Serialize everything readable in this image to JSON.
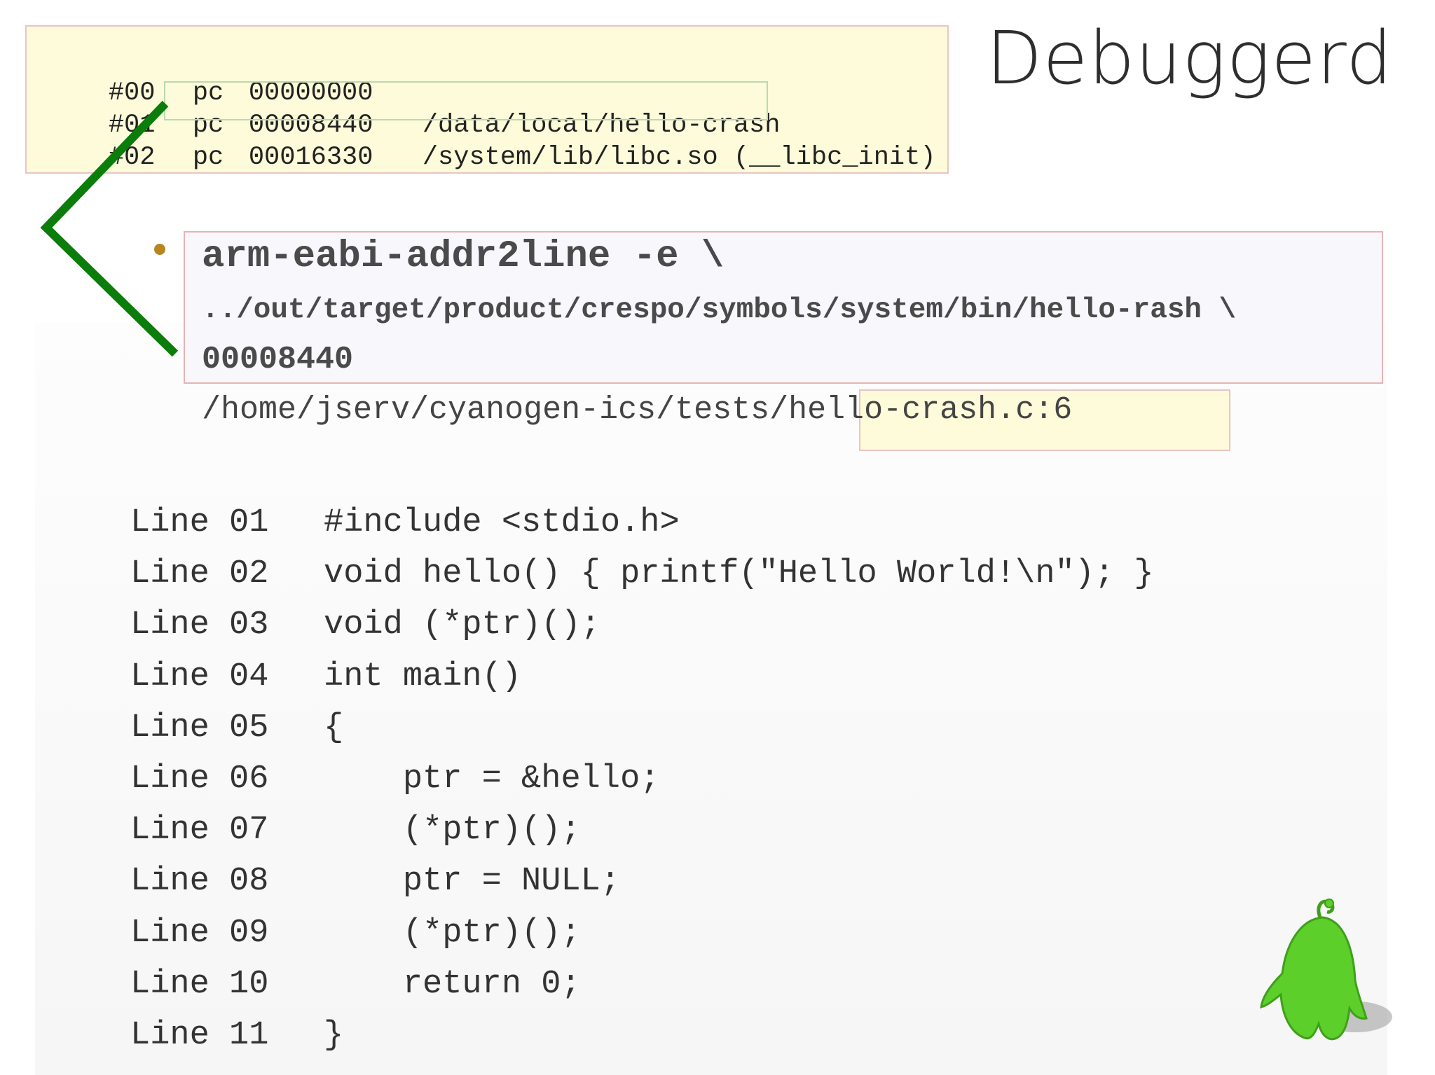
{
  "title": "Debuggerd",
  "backtrace": [
    {
      "frame": "#00",
      "pc": "pc",
      "addr": "00000000",
      "lib": ""
    },
    {
      "frame": "#01",
      "pc": "pc",
      "addr": "00008440",
      "lib": "/data/local/hello-crash"
    },
    {
      "frame": "#02",
      "pc": "pc",
      "addr": "00016330",
      "lib": "/system/lib/libc.so (__libc_init)"
    }
  ],
  "command": {
    "line1": "arm-eabi-addr2line -e \\",
    "line2": "../out/target/product/crespo/symbols/system/bin/hello-rash \\",
    "line3": "00008440"
  },
  "result": "/home/jserv/cyanogen-ics/tests/hello-crash.c:6",
  "source": [
    {
      "line": "Line 01",
      "code": "#include <stdio.h>"
    },
    {
      "line": "Line 02",
      "code": "void hello() { printf(\"Hello World!\\n\"); }"
    },
    {
      "line": "Line 03",
      "code": "void (*ptr)();"
    },
    {
      "line": "Line 04",
      "code": "int main()"
    },
    {
      "line": "Line 05",
      "code": "{"
    },
    {
      "line": "Line 06",
      "code": "    ptr = &hello;"
    },
    {
      "line": "Line 07",
      "code": "    (*ptr)();"
    },
    {
      "line": "Line 08",
      "code": "    ptr = NULL;"
    },
    {
      "line": "Line 09",
      "code": "    (*ptr)();"
    },
    {
      "line": "Line 10",
      "code": "    return 0;"
    },
    {
      "line": "Line 11",
      "code": "}"
    }
  ],
  "colors": {
    "arrow": "#0a7d0a",
    "highlight_fill": "#fdfbd9",
    "mascot": "#5ccf2a"
  },
  "icons": {
    "arrow": "green-chevron-arrow",
    "mascot": "android-mascot-icon"
  }
}
